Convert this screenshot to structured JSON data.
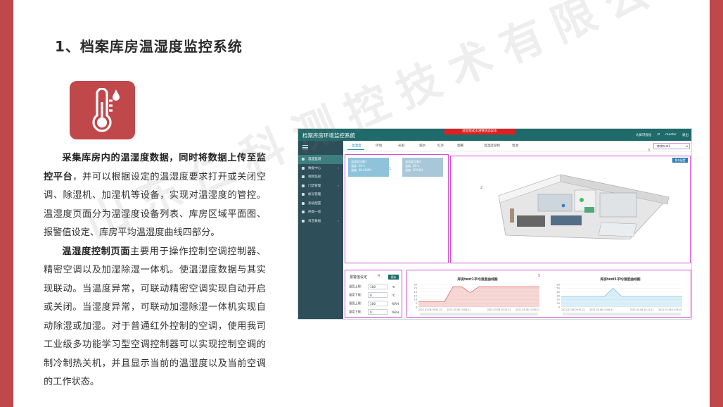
{
  "title": "1、档案库房温湿度监控系统",
  "icon": "thermometer-icon",
  "colors": {
    "accent": "#c0474a",
    "appHeader": "#1f6b6b",
    "sidebar": "#2e4e59"
  },
  "paragraph1": {
    "bold": "采集库房内的温湿度数据，同时将数据上传至监控平台",
    "rest": "，并可以根据设定的温湿度要求打开或关闭空调、除湿机、加湿机等设备，实现对温湿度的管控。温湿度页面分为温湿度设备列表、库房区域平面图、报警值设定、库房平均温湿度曲线四部分。"
  },
  "paragraph2": {
    "bold": "温湿度控制页面",
    "rest": "主要用于操作控制空调控制器、精密空调以及加湿除湿一体机。使温湿度数据与其实现联动。当温度异常，可联动精密空调实现自动开启或关闭。当湿度异常，可联动加湿除湿一体机实现自动除湿或加湿。对于普通红外控制的空调，使用我司工业级多功能学习型空调控制器可以实现控制空调的制冷制热关机，并且显示当前的温湿度以及当前空调的工作状态。"
  },
  "watermark": "山东仁科测控技术有限公司",
  "screenshot": {
    "app_title": "档案库房环境监控系统",
    "alarm_banner": "前堂组式水浸铁状态异水",
    "top_right": [
      "大屏可视化",
      "⇄",
      "master",
      "退出"
    ],
    "nav": [
      {
        "label": "温湿监测",
        "active": true,
        "caret": ""
      },
      {
        "label": "数据中心",
        "active": false,
        "caret": "›"
      },
      {
        "label": "视频监控",
        "active": false,
        "caret": ""
      },
      {
        "label": "门禁管理",
        "active": false,
        "caret": "›"
      },
      {
        "label": "帐号管理",
        "active": false,
        "caret": ""
      },
      {
        "label": "系统配置",
        "active": false,
        "caret": ""
      },
      {
        "label": "终端一览",
        "active": false,
        "caret": ""
      },
      {
        "label": "日志数据",
        "active": false,
        "caret": "›"
      }
    ],
    "tabs": [
      "温湿度",
      "环境",
      "光照",
      "漏水",
      "红外",
      "烟雾",
      "温湿度控制",
      "电源"
    ],
    "area_select": "库房test1",
    "panel_numbers": [
      "1",
      "2",
      "3",
      "4",
      "5"
    ],
    "devices": [
      {
        "name": "温湿度设备1",
        "temp": "温度: 25℃",
        "hum": "湿度: 56.4%RH"
      },
      {
        "name": "温湿度设备2",
        "temp": "温度: 26℃",
        "hum": "湿度: 50%RH"
      }
    ],
    "plan_button": "保存配置",
    "alarm_form": {
      "title": "报警值设定",
      "save": "保存",
      "rows": [
        {
          "label": "温度上限:",
          "value": "100",
          "unit": "℃"
        },
        {
          "label": "温度下限:",
          "value": "0",
          "unit": "℃"
        },
        {
          "label": "湿度上限:",
          "value": "100",
          "unit": "%RH"
        },
        {
          "label": "湿度下限:",
          "value": "0",
          "unit": "%RH"
        }
      ]
    },
    "charts": [
      {
        "title": "库房test1平均温度曲线图"
      },
      {
        "title": "库房test1平均湿度曲线图"
      }
    ]
  },
  "chart_data": [
    {
      "type": "area",
      "title": "库房test1平均温度曲线图",
      "x": [
        "2021-03-06 09:51:21",
        "2021-03-06 10:06:21",
        "2021-03-06 10:21:21",
        "2021-03-06 10:36:21"
      ],
      "y_ticks": [
        "0",
        "5",
        "10",
        "15",
        "20",
        "25",
        "30"
      ],
      "ylim": [
        0,
        30
      ],
      "series": [
        {
          "values": [
            7,
            7,
            7,
            7,
            27,
            27,
            19,
            27,
            27,
            27,
            27,
            27,
            27,
            27,
            27
          ]
        }
      ],
      "color": "#e26b6b"
    },
    {
      "type": "area",
      "title": "库房test1平均湿度曲线图",
      "x": [
        "2021-03-06 09:51:21",
        "2021-03-06 10:06:21",
        "2021-03-06 10:21:21",
        "2021-03-06 10:36:21"
      ],
      "y_ticks": [
        "0",
        "10",
        "20",
        "30",
        "40",
        "50",
        "60"
      ],
      "ylim": [
        0,
        60
      ],
      "series": [
        {
          "values": [
            28,
            28,
            28,
            28,
            28,
            28,
            50,
            28,
            28,
            28,
            28,
            28,
            28,
            28,
            28
          ]
        }
      ],
      "color": "#7fc6e6"
    }
  ]
}
